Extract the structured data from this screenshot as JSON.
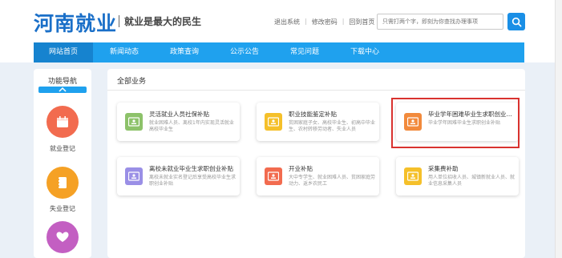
{
  "header": {
    "logo": "河南就业",
    "slogan": "就业是最大的民生",
    "links": [
      "退出系统",
      "修改密码",
      "回到首页"
    ],
    "search_placeholder": "只需打两个字，即刻为你查找办理事项"
  },
  "nav": {
    "items": [
      "网站首页",
      "新闻动态",
      "政策查询",
      "公示公告",
      "常见问题",
      "下载中心"
    ],
    "active_index": 0
  },
  "sidebar": {
    "title": "功能导航",
    "items": [
      {
        "label": "就业登记",
        "icon": "calendar-icon",
        "color": "#f26b4f"
      },
      {
        "label": "失业登记",
        "icon": "notebook-icon",
        "color": "#f5a125"
      },
      {
        "label": "",
        "icon": "heart-icon",
        "color": "#c35fc2"
      }
    ]
  },
  "main": {
    "title": "全部业务",
    "cards": [
      {
        "title": "灵活就业人员社保补贴",
        "desc": "就业困难人员、离校1年内实现灵活就业高校毕业生",
        "icon": "id-card-icon",
        "color": "#8dc26a"
      },
      {
        "title": "职业技能鉴定补贴",
        "desc": "贫困家庭子女、高校毕业生、初高中毕业生、农村转移劳动者、失业人员",
        "icon": "id-card-icon",
        "color": "#f5c02a"
      },
      {
        "title": "毕业学年困难毕业生求职创业...",
        "desc": "毕业学年困难毕业生求职创业补贴",
        "icon": "id-card-icon",
        "color": "#f28a3c"
      },
      {
        "title": "离校未就业毕业生求职创业补贴",
        "desc": "离校未就业实名登记后享受高校毕业生求职创业补贴",
        "icon": "id-card-icon",
        "color": "#9a8fe6"
      },
      {
        "title": "开业补贴",
        "desc": "大中专学生、就业困难人员、贫困家庭劳动力、返乡农民工",
        "icon": "id-card-icon",
        "color": "#f26b4f"
      },
      {
        "title": "采集费补助",
        "desc": "用人单位招收人员、城镇新就业人员、就业信息采集人员",
        "icon": "id-card-icon",
        "color": "#f5c02a"
      }
    ]
  }
}
